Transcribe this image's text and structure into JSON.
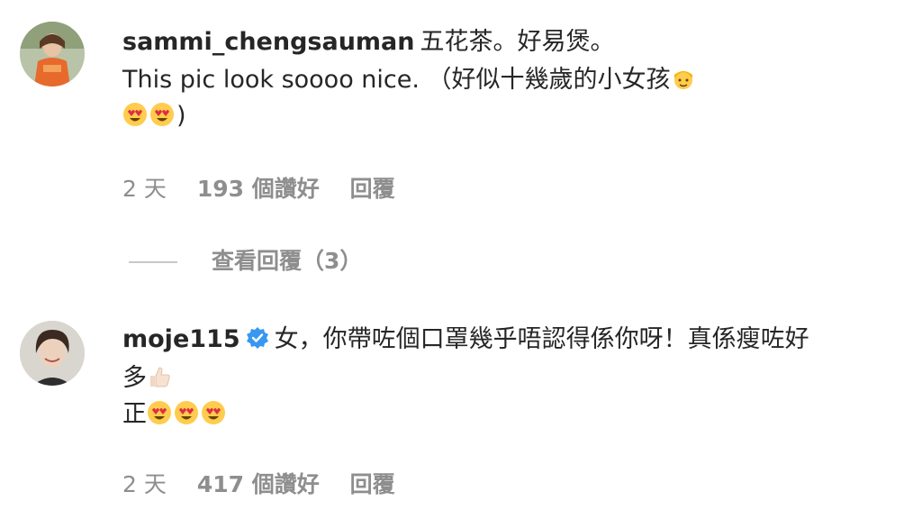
{
  "comments": [
    {
      "username": "sammi_chengsauman",
      "line1_text": "五花茶。好易煲。",
      "line2_text": "This pic look soooo nice. （好似十幾歲的小女孩",
      "line2_emoji": "girl-emoji",
      "line3_emojis": [
        "heart-eyes-emoji",
        "heart-eyes-emoji"
      ],
      "line3_text": ")",
      "time": "2 天",
      "likes": "193 個讚好",
      "reply": "回覆",
      "view_replies": "查看回覆（3）"
    },
    {
      "username": "moje115",
      "verified": true,
      "line1_text": "女，你帶咗個口罩幾乎唔認得係你呀！真係瘦咗好",
      "line2_text": "多",
      "line2_emoji": "thumbs-up-emoji",
      "line3_text": "正",
      "line3_emojis": [
        "heart-eyes-emoji",
        "heart-eyes-emoji",
        "heart-eyes-emoji"
      ],
      "time": "2 天",
      "likes": "417 個讚好",
      "reply": "回覆"
    }
  ],
  "colors": {
    "text": "#262626",
    "meta": "#8e8e8e",
    "verified": "#3897f0"
  }
}
